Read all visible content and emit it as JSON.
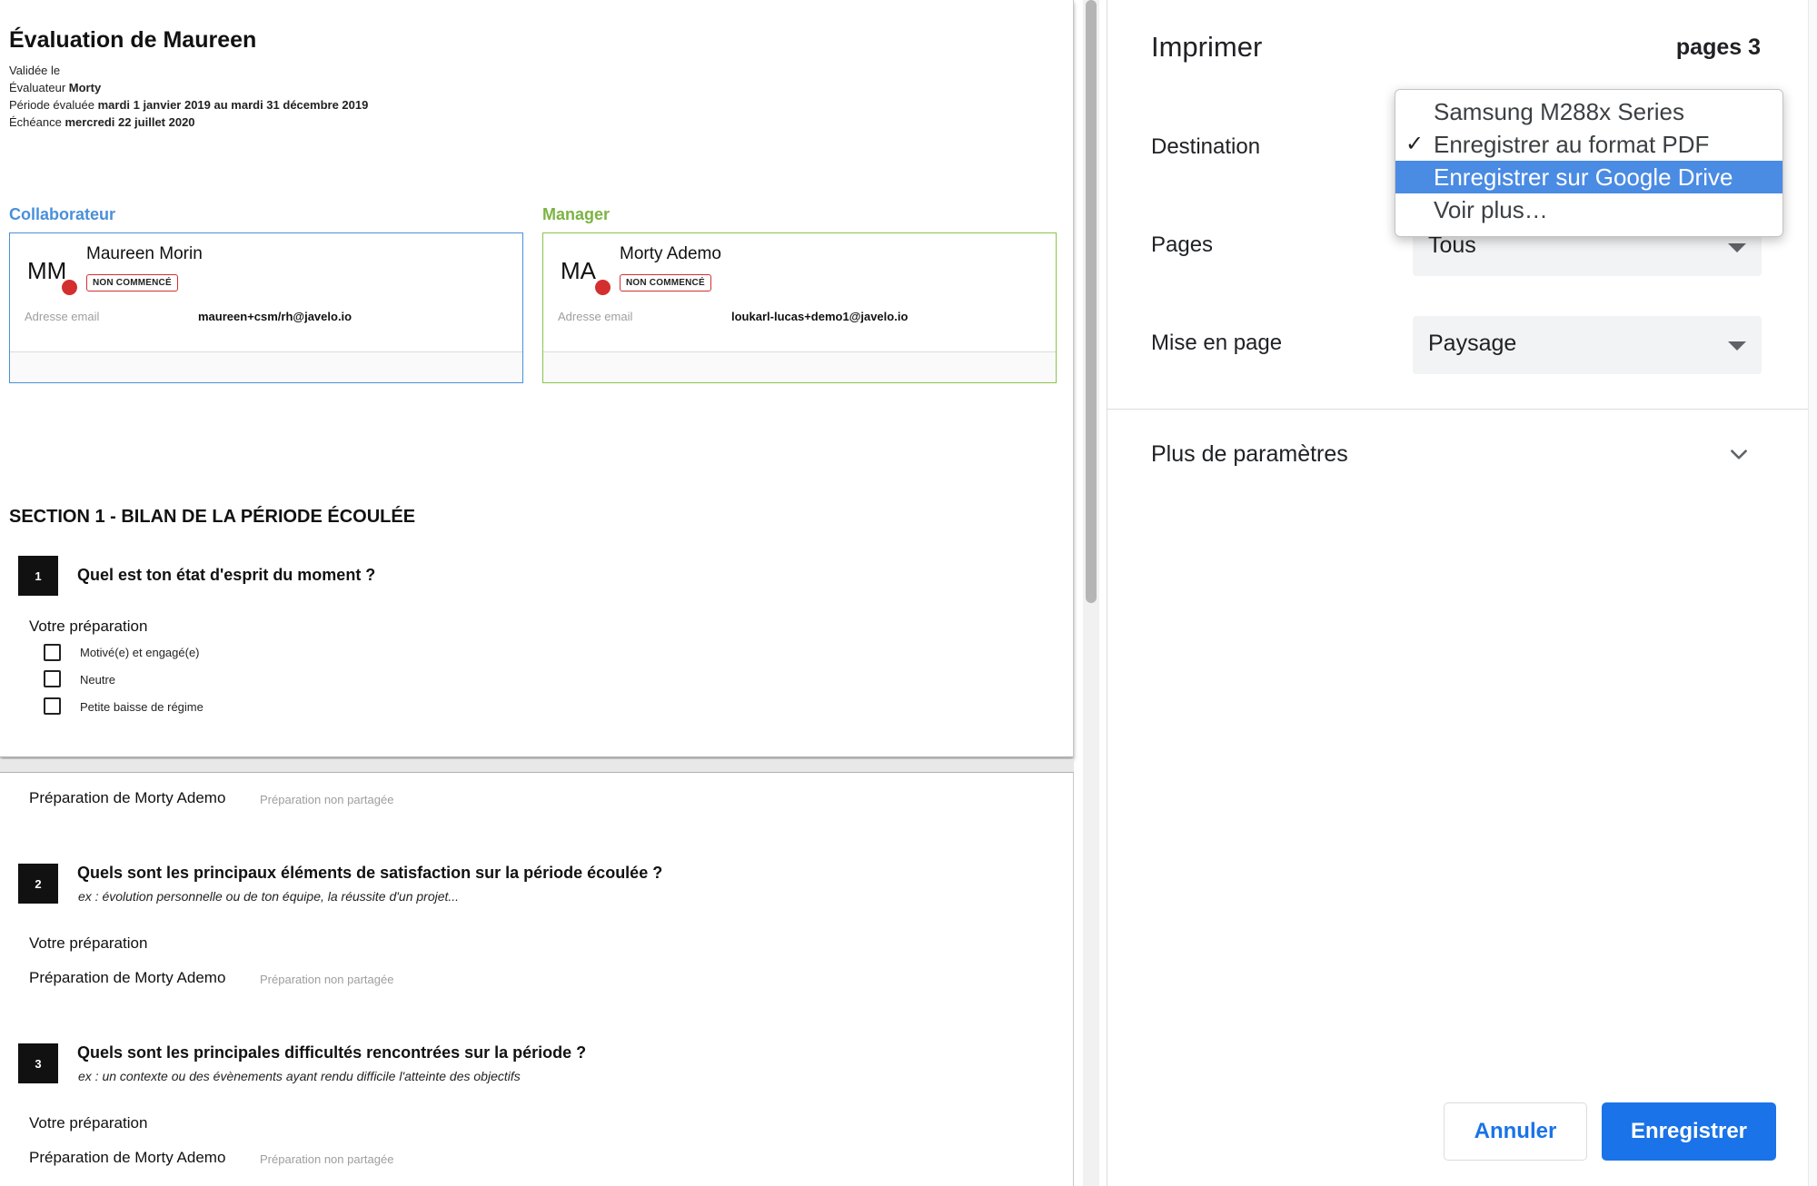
{
  "preview": {
    "title": "Évaluation de Maureen",
    "meta": {
      "validated_label": "Validée le",
      "evaluator_label": "Évaluateur",
      "evaluator_value": "Morty",
      "period_label": "Période évaluée",
      "period_value": "mardi 1 janvier 2019 au mardi 31 décembre 2019",
      "deadline_label": "Échéance",
      "deadline_value": "mercredi 22 juillet 2020"
    },
    "collaborator": {
      "role": "Collaborateur",
      "initials": "MM",
      "name": "Maureen Morin",
      "status": "NON COMMENCÉ",
      "email_label": "Adresse email",
      "email": "maureen+csm/rh@javelo.io",
      "color": "#4a90d9"
    },
    "manager": {
      "role": "Manager",
      "initials": "MA",
      "name": "Morty Ademo",
      "status": "NON COMMENCÉ",
      "email_label": "Adresse email",
      "email": "loukarl-lucas+demo1@javelo.io",
      "color": "#7cb342"
    },
    "section_title": "SECTION 1 - BILAN DE LA PÉRIODE ÉCOULÉE",
    "questions": [
      {
        "number": "1",
        "text": "Quel est ton état d'esprit du moment ?",
        "prep_label": "Votre préparation",
        "options": [
          "Motivé(e) et engagé(e)",
          "Neutre",
          "Petite baisse de régime"
        ],
        "manager_prep_label": "Préparation de Morty Ademo",
        "manager_prep_status": "Préparation non partagée"
      },
      {
        "number": "2",
        "text": "Quels sont les principaux éléments de satisfaction sur la période écoulée ?",
        "hint": "ex : évolution personnelle ou de ton équipe, la réussite d'un projet...",
        "prep_label": "Votre préparation",
        "manager_prep_label": "Préparation de Morty Ademo",
        "manager_prep_status": "Préparation non partagée"
      },
      {
        "number": "3",
        "text": "Quels sont les principales difficultés rencontrées sur la période ?",
        "hint": "ex : un contexte ou des évènements ayant rendu difficile l'atteinte des objectifs",
        "prep_label": "Votre préparation",
        "manager_prep_label": "Préparation de Morty Ademo",
        "manager_prep_status": "Préparation non partagée"
      }
    ]
  },
  "print_panel": {
    "title": "Imprimer",
    "page_count": "pages 3",
    "destination_label": "Destination",
    "destination_options": [
      {
        "label": "Samsung M288x Series",
        "checked": false,
        "highlighted": false
      },
      {
        "label": "Enregistrer au format PDF",
        "checked": true,
        "highlighted": false
      },
      {
        "label": "Enregistrer sur Google Drive",
        "checked": false,
        "highlighted": true
      },
      {
        "label": "Voir plus…",
        "checked": false,
        "highlighted": false
      }
    ],
    "check_mark": "✓",
    "pages_label": "Pages",
    "pages_value": "Tous",
    "layout_label": "Mise en page",
    "layout_value": "Paysage",
    "more_settings_label": "Plus de paramètres",
    "cancel_label": "Annuler",
    "save_label": "Enregistrer",
    "accent_color": "#1a73e8"
  }
}
